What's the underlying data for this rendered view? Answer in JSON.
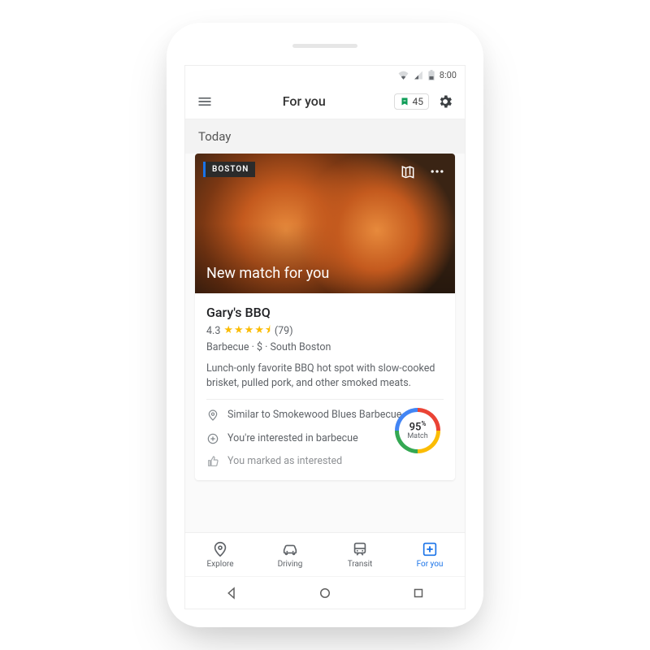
{
  "status": {
    "time": "8:00"
  },
  "header": {
    "title": "For you",
    "points": "45"
  },
  "section": {
    "label": "Today"
  },
  "card": {
    "tag": "BOSTON",
    "overlay_title": "New match for you",
    "place_name": "Gary's BBQ",
    "rating": "4.3",
    "review_count": "(79)",
    "category_line": "Barbecue · $ · South Boston",
    "description": "Lunch-only favorite BBQ hot spot with slow-cooked brisket, pulled pork, and other smoked meats.",
    "reasons": [
      "Similar to Smokewood Blues Barbecue",
      "You're interested in barbecue",
      "You marked as interested"
    ],
    "match": {
      "percent": "95",
      "label": "Match"
    }
  },
  "nav": {
    "explore": "Explore",
    "driving": "Driving",
    "transit": "Transit",
    "for_you": "For you"
  }
}
